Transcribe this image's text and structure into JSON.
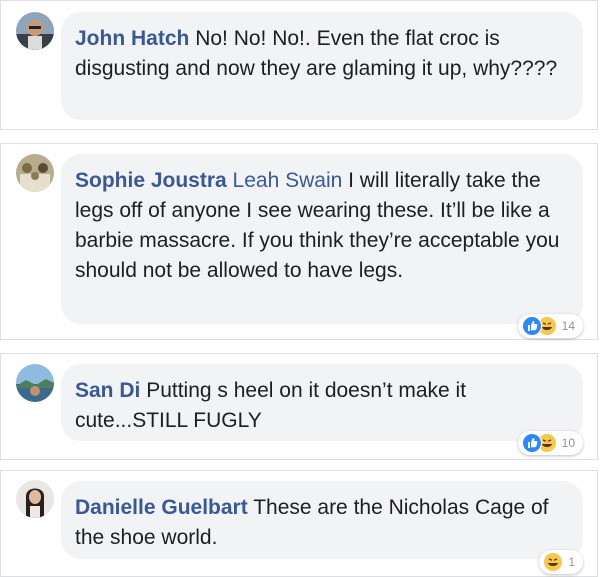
{
  "comments": [
    {
      "author": "John Hatch",
      "text": "No! No! No!. Even the flat croc is disgusting and now they are glaming it up, why????",
      "reactions": null
    },
    {
      "author": "Sophie Joustra",
      "tag": "Leah Swain",
      "text": "I will literally take the legs off of anyone I see wearing these. It’ll be like a barbie massacre. If you think they’re acceptable you should not be allowed to have legs.",
      "reactions": {
        "icons": [
          "like-icon",
          "haha-icon"
        ],
        "count": "14"
      }
    },
    {
      "author": "San Di",
      "text": "Putting s heel on it doesn’t make it cute...STILL FUGLY",
      "reactions": {
        "icons": [
          "like-icon",
          "haha-icon"
        ],
        "count": "10"
      }
    },
    {
      "author": "Danielle Guelbart",
      "text": "These are the Nicholas Cage of the shoe world.",
      "reactions": {
        "icons": [
          "haha-icon"
        ],
        "count": "1"
      }
    }
  ],
  "colors": {
    "author": "#385898",
    "bubble": "#f2f3f5",
    "like": "#2d88ff",
    "haha": "#f7c84b"
  }
}
